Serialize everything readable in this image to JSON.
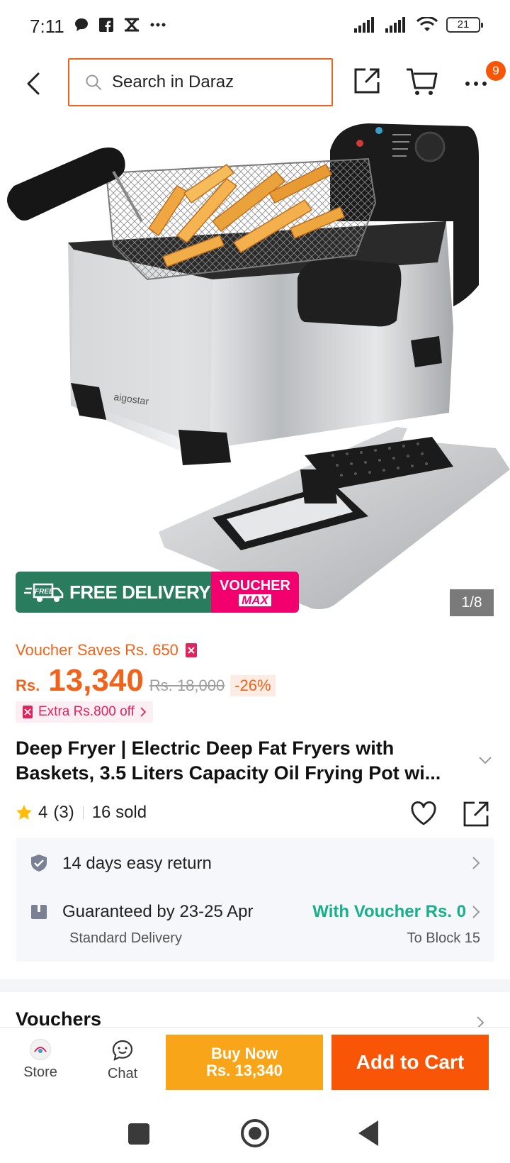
{
  "status_bar": {
    "time": "7:11",
    "battery": "21",
    "icons": [
      "chat-bubble-icon",
      "facebook-icon",
      "app-icon",
      "more-dots-icon",
      "signal-icon",
      "signal-icon",
      "wifi-icon",
      "battery-icon"
    ]
  },
  "header": {
    "search_placeholder": "Search in Daraz",
    "cart_badge": "9"
  },
  "gallery": {
    "counter": "1/8",
    "brand_mark": "aigostar",
    "promo_free": "FREE",
    "promo_free_delivery": "FREE DELIVERY",
    "promo_voucher": "VOUCHER",
    "promo_max": "MAX"
  },
  "pricing": {
    "voucher_saves": "Voucher Saves Rs. 650",
    "currency": "Rs.",
    "price": "13,340",
    "original_price": "Rs. 18,000",
    "discount": "-26%",
    "extra_off": "Extra Rs.800 off"
  },
  "product": {
    "title_line_1": "Deep Fryer | Electric Deep Fat Fryers with",
    "title_line_2": "Baskets, 3.5 Liters Capacity Oil Frying Pot wi...",
    "rating": "4",
    "rating_count": "(3)",
    "sold": "16 sold"
  },
  "services": {
    "returns": "14 days easy return",
    "guarantee": "Guaranteed by 23-25 Apr",
    "delivery_type": "Standard Delivery",
    "voucher_note": "With Voucher Rs. 0",
    "location": "To Block 15"
  },
  "sections": {
    "vouchers": "Vouchers"
  },
  "actions": {
    "store": "Store",
    "chat": "Chat",
    "buy_now": "Buy Now",
    "buy_now_price": "Rs. 13,340",
    "add_to_cart": "Add to Cart"
  },
  "colors": {
    "brand_orange": "#f85606",
    "buy_now": "#f9a51a",
    "free_delivery_green": "#2a7c5f",
    "voucher_pink": "#f2006e",
    "voucher_teal": "#18b08a"
  }
}
